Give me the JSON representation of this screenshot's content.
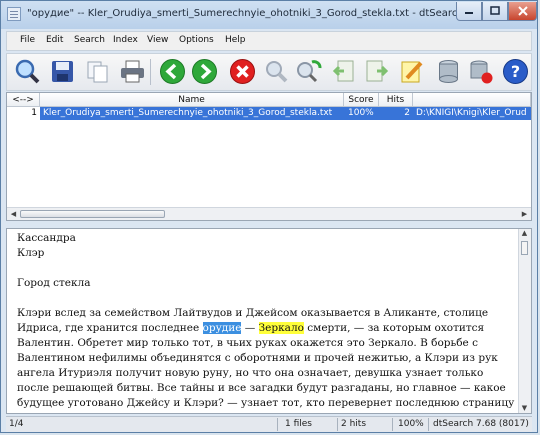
{
  "window": {
    "title": "\"орудие\" -- Kler_Orudiya_smerti_Sumerechnyie_ohotniki_3_Gorod_stekla.txt - dtSearch"
  },
  "menu": [
    "File",
    "Edit",
    "Search",
    "Index",
    "View",
    "Options",
    "Help"
  ],
  "toolbar": [
    "search-icon",
    "save-icon",
    "copy-icon",
    "print-icon",
    "back-icon",
    "forward-icon",
    "stop-icon",
    "browse-words-icon",
    "refresh-icon",
    "prev-hit-icon",
    "next-hit-icon",
    "edit-icon",
    "index-icon",
    "update-index-icon",
    "help-icon"
  ],
  "columns": {
    "nav": "<-->",
    "name": "Name",
    "score": "Score",
    "hits": "Hits"
  },
  "results": [
    {
      "num": "1",
      "name": "Kler_Orudiya_smerti_Sumerechnyie_ohotniki_3_Gorod_stekla.txt",
      "score": "100%",
      "hits": "2",
      "path": "D:\\KNIGI\\Knigi\\Kler_Orud"
    }
  ],
  "document": {
    "lines": [
      "Кассандра",
      "Клэр",
      "",
      "Город стекла",
      ""
    ],
    "para_before": "Клэри вслед за семейством Лайтвудов и Джейсом оказывается в Аликанте, столице Идриса, где хранится последнее ",
    "hit1": "орудие",
    "dash": " — ",
    "hit2": "Зеркало",
    "para_after": " смерти, — за которым охотится Валентин. Обретет мир только тот, в чьих руках окажется это Зеркало. В борьбе с Валентином нефилимы объединятся с оборотнями и прочей нежитью, а Клэри из рук ангела Итуриэля получит новую руну, но что она означает, девушка узнает только после решающей битвы. Все тайны и все загадки будут разгаданы, но главное — какое будущее уготовано Джейсу и Клэри? — узнает тот, кто перевернет последнюю страницу трилогии."
  },
  "status": {
    "position": "1/4",
    "files": "1 files",
    "hits": "2 hits",
    "zoom": "100%",
    "version": "dtSearch 7.68 (8017)"
  }
}
